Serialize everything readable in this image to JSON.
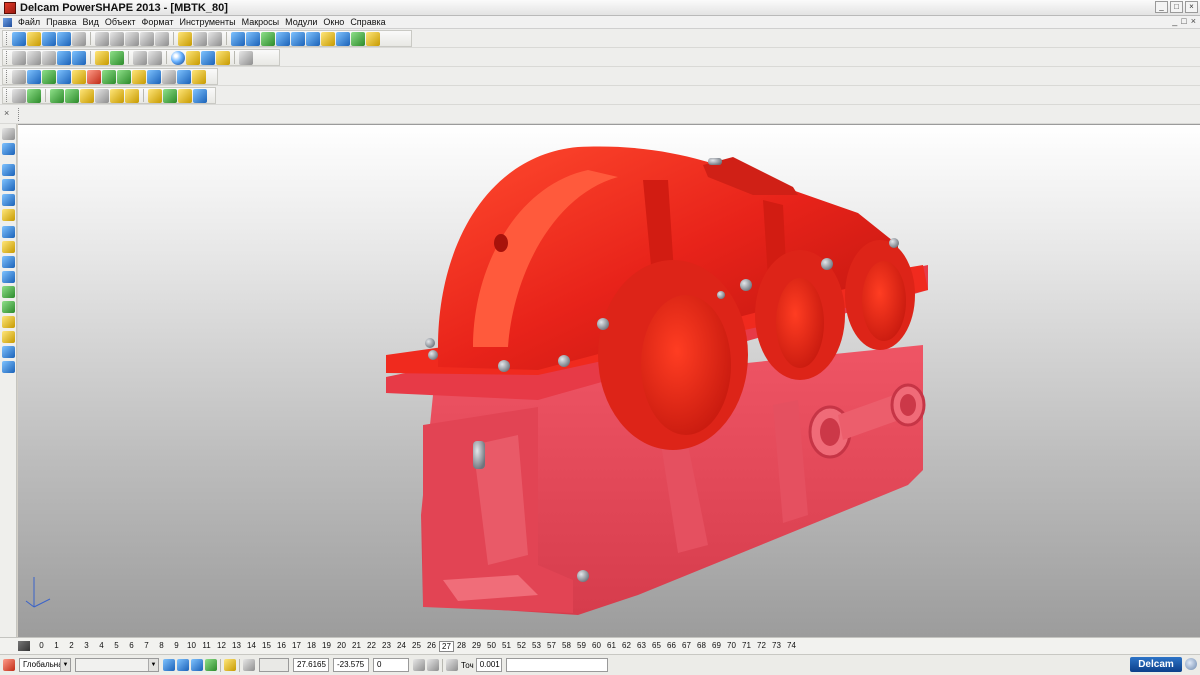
{
  "window": {
    "title": "Delcam PowerSHAPE 2013 - [MBTK_80]",
    "minimize": "_",
    "maximize": "□",
    "close": "×"
  },
  "menu": [
    "Файл",
    "Правка",
    "Вид",
    "Объект",
    "Формат",
    "Инструменты",
    "Макросы",
    "Модули",
    "Окно",
    "Справка"
  ],
  "mdi_controls": [
    "_",
    "□",
    "×"
  ],
  "levels": {
    "label_icon": "levels-icon",
    "items": [
      "0",
      "1",
      "2",
      "3",
      "4",
      "5",
      "6",
      "7",
      "8",
      "9",
      "10",
      "11",
      "12",
      "13",
      "14",
      "15",
      "16",
      "17",
      "18",
      "19",
      "20",
      "21",
      "22",
      "23",
      "24",
      "25",
      "26",
      "27",
      "28",
      "29",
      "50",
      "51",
      "52",
      "53",
      "57",
      "58",
      "59",
      "60",
      "61",
      "62",
      "63",
      "65",
      "66",
      "67",
      "68",
      "69",
      "70",
      "71",
      "72",
      "73",
      "74"
    ],
    "active": "27"
  },
  "status": {
    "workplane": "Глобальна",
    "coord_x": "27.6165",
    "coord_y": "-23.575",
    "coord_z": "0",
    "tolerance_label": "Точ",
    "tolerance_value": "0.001"
  },
  "brand": "Delcam",
  "colors": {
    "model_red": "#e8231a",
    "model_lower": "#e44a58",
    "bolt": "#9aa0a8"
  }
}
